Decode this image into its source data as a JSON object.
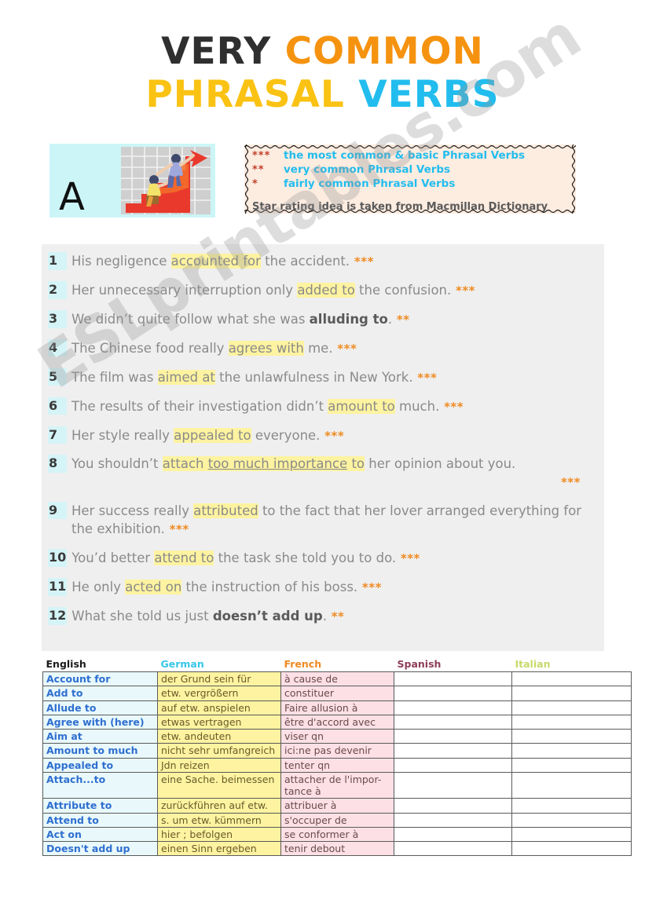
{
  "title": {
    "line1_part1": "VERY",
    "line1_part2": "COMMON",
    "line2_part1": "PHRASAL",
    "line2_part2": "VERBS",
    "colors": {
      "very": "#2f2f2f",
      "common": "#f59310",
      "phrasal": "#fac213",
      "verbs": "#22bdee"
    }
  },
  "letter_banner": {
    "letter": "A",
    "clipart_name": "businessmen-climbing-red-arrow-chart",
    "background": "#ccf5f7"
  },
  "legend": {
    "rows": [
      {
        "stars": "***",
        "text": "the most common & basic Phrasal Verbs"
      },
      {
        "stars": "**",
        "text": "very common Phrasal Verbs"
      },
      {
        "stars": "*",
        "text": "fairly common Phrasal Verbs"
      }
    ],
    "note": "Star rating idea is taken from Macmillan Dictionary",
    "star_color": "#c2402b",
    "text_color": "#22bdee",
    "background": "#fdece0"
  },
  "sentences": [
    {
      "num": "1",
      "parts": [
        {
          "t": "His negligence ",
          "s": "plain"
        },
        {
          "t": "accounted for",
          "s": "hl"
        },
        {
          "t": " the accident.",
          "s": "plain"
        }
      ],
      "stars": "***",
      "stars_position": "inline"
    },
    {
      "num": "2",
      "parts": [
        {
          "t": "Her unnecessary interruption only ",
          "s": "plain"
        },
        {
          "t": "added to",
          "s": "hl"
        },
        {
          "t": " the confusion.",
          "s": "plain"
        }
      ],
      "stars": "***",
      "stars_position": "inline"
    },
    {
      "num": "3",
      "parts": [
        {
          "t": "We didn’t quite follow what she was ",
          "s": "plain"
        },
        {
          "t": "alluding to",
          "s": "bold"
        },
        {
          "t": ".",
          "s": "plain"
        }
      ],
      "stars": "**",
      "stars_position": "inline"
    },
    {
      "num": "4",
      "parts": [
        {
          "t": "The Chinese food really ",
          "s": "plain"
        },
        {
          "t": "agrees with",
          "s": "hl"
        },
        {
          "t": " me.",
          "s": "plain"
        }
      ],
      "stars": "***",
      "stars_position": "inline"
    },
    {
      "num": "5",
      "parts": [
        {
          "t": "The film was ",
          "s": "plain"
        },
        {
          "t": "aimed at",
          "s": "hl"
        },
        {
          "t": " the unlawfulness in New York.",
          "s": "plain"
        }
      ],
      "stars": "***",
      "stars_position": "inline"
    },
    {
      "num": "6",
      "parts": [
        {
          "t": "The results of their investigation didn’t ",
          "s": "plain"
        },
        {
          "t": "amount to",
          "s": "hl"
        },
        {
          "t": " much.",
          "s": "plain"
        }
      ],
      "stars": "***",
      "stars_position": "inline"
    },
    {
      "num": "7",
      "parts": [
        {
          "t": "Her style really ",
          "s": "plain"
        },
        {
          "t": "appealed to",
          "s": "hl"
        },
        {
          "t": " everyone.",
          "s": "plain"
        }
      ],
      "stars": "***",
      "stars_position": "inline"
    },
    {
      "num": "8",
      "parts": [
        {
          "t": "You shouldn’t ",
          "s": "plain"
        },
        {
          "t": "attach ",
          "s": "hl"
        },
        {
          "t": "too much importance",
          "s": "hl-u"
        },
        {
          "t": " to",
          "s": "hl"
        },
        {
          "t": " her opinion about you.",
          "s": "plain"
        }
      ],
      "stars": "***",
      "stars_position": "next-line-right"
    },
    {
      "num": "9",
      "parts": [
        {
          "t": "Her success really ",
          "s": "plain"
        },
        {
          "t": "attributed",
          "s": "hl"
        },
        {
          "t": " to the fact that her lover arranged everything for the exhibition.",
          "s": "plain"
        }
      ],
      "stars": "***",
      "stars_position": "inline"
    },
    {
      "num": "10",
      "parts": [
        {
          "t": "You’d better ",
          "s": "plain"
        },
        {
          "t": "attend to",
          "s": "hl"
        },
        {
          "t": " the task she told you to do.",
          "s": "plain"
        }
      ],
      "stars": "***",
      "stars_position": "inline"
    },
    {
      "num": "11",
      "parts": [
        {
          "t": "He only ",
          "s": "plain"
        },
        {
          "t": "acted on",
          "s": "hl"
        },
        {
          "t": " the instruction of his boss.",
          "s": "plain"
        }
      ],
      "stars": "***",
      "stars_position": "inline"
    },
    {
      "num": "12",
      "parts": [
        {
          "t": "What she told us just ",
          "s": "plain"
        },
        {
          "t": "doesn’t add up",
          "s": "bold"
        },
        {
          "t": ".",
          "s": "plain"
        }
      ],
      "stars": "**",
      "stars_position": "inline"
    }
  ],
  "table": {
    "headers": [
      "English",
      "German",
      "French",
      "Spanish",
      "Italian"
    ],
    "header_colors": {
      "English": "#1a1a1a",
      "German": "#35c6e8",
      "French": "#ef8b22",
      "Spanish": "#8d3e56",
      "Italian": "#c8d96a"
    },
    "rows": [
      {
        "english": "Account for",
        "german": "der Grund sein für",
        "french": "à cause de",
        "spanish": "",
        "italian": ""
      },
      {
        "english": "Add to",
        "german": "etw. vergrößern",
        "french": "constituer",
        "spanish": "",
        "italian": ""
      },
      {
        "english": "Allude to",
        "german": "auf  etw. anspielen",
        "french": "Faire allusion à",
        "spanish": "",
        "italian": ""
      },
      {
        "english": "Agree with (here)",
        "german": "etwas vertragen",
        "french": "être d'accord avec",
        "spanish": "",
        "italian": ""
      },
      {
        "english": "Aim at",
        "german": "etw. andeuten",
        "french": "viser qn",
        "spanish": "",
        "italian": ""
      },
      {
        "english": "Amount to much",
        "german": "nicht sehr umfangreich",
        "french": "ici:ne pas devenir",
        "spanish": "",
        "italian": ""
      },
      {
        "english": "Appealed to",
        "german": "Jdn reizen",
        "french": "tenter qn",
        "spanish": "",
        "italian": ""
      },
      {
        "english": "Attach...to",
        "german": "eine Sache. beimessen",
        "french": "attacher de l'impor-\ntance à",
        "spanish": "",
        "italian": ""
      },
      {
        "english": "Attribute to",
        "german": "zurückführen auf etw.",
        "french": "attribuer à",
        "spanish": "",
        "italian": ""
      },
      {
        "english": "Attend to",
        "german": "s. um etw. kümmern",
        "french": "s'occuper de",
        "spanish": "",
        "italian": ""
      },
      {
        "english": "Act on",
        "german": "hier ; befolgen",
        "french": "se conformer à",
        "spanish": "",
        "italian": ""
      },
      {
        "english": "Doesn't add up",
        "german": "einen Sinn ergeben",
        "french": "tenir debout",
        "spanish": "",
        "italian": ""
      }
    ]
  },
  "watermark": {
    "text": "ESLprintables.com"
  }
}
